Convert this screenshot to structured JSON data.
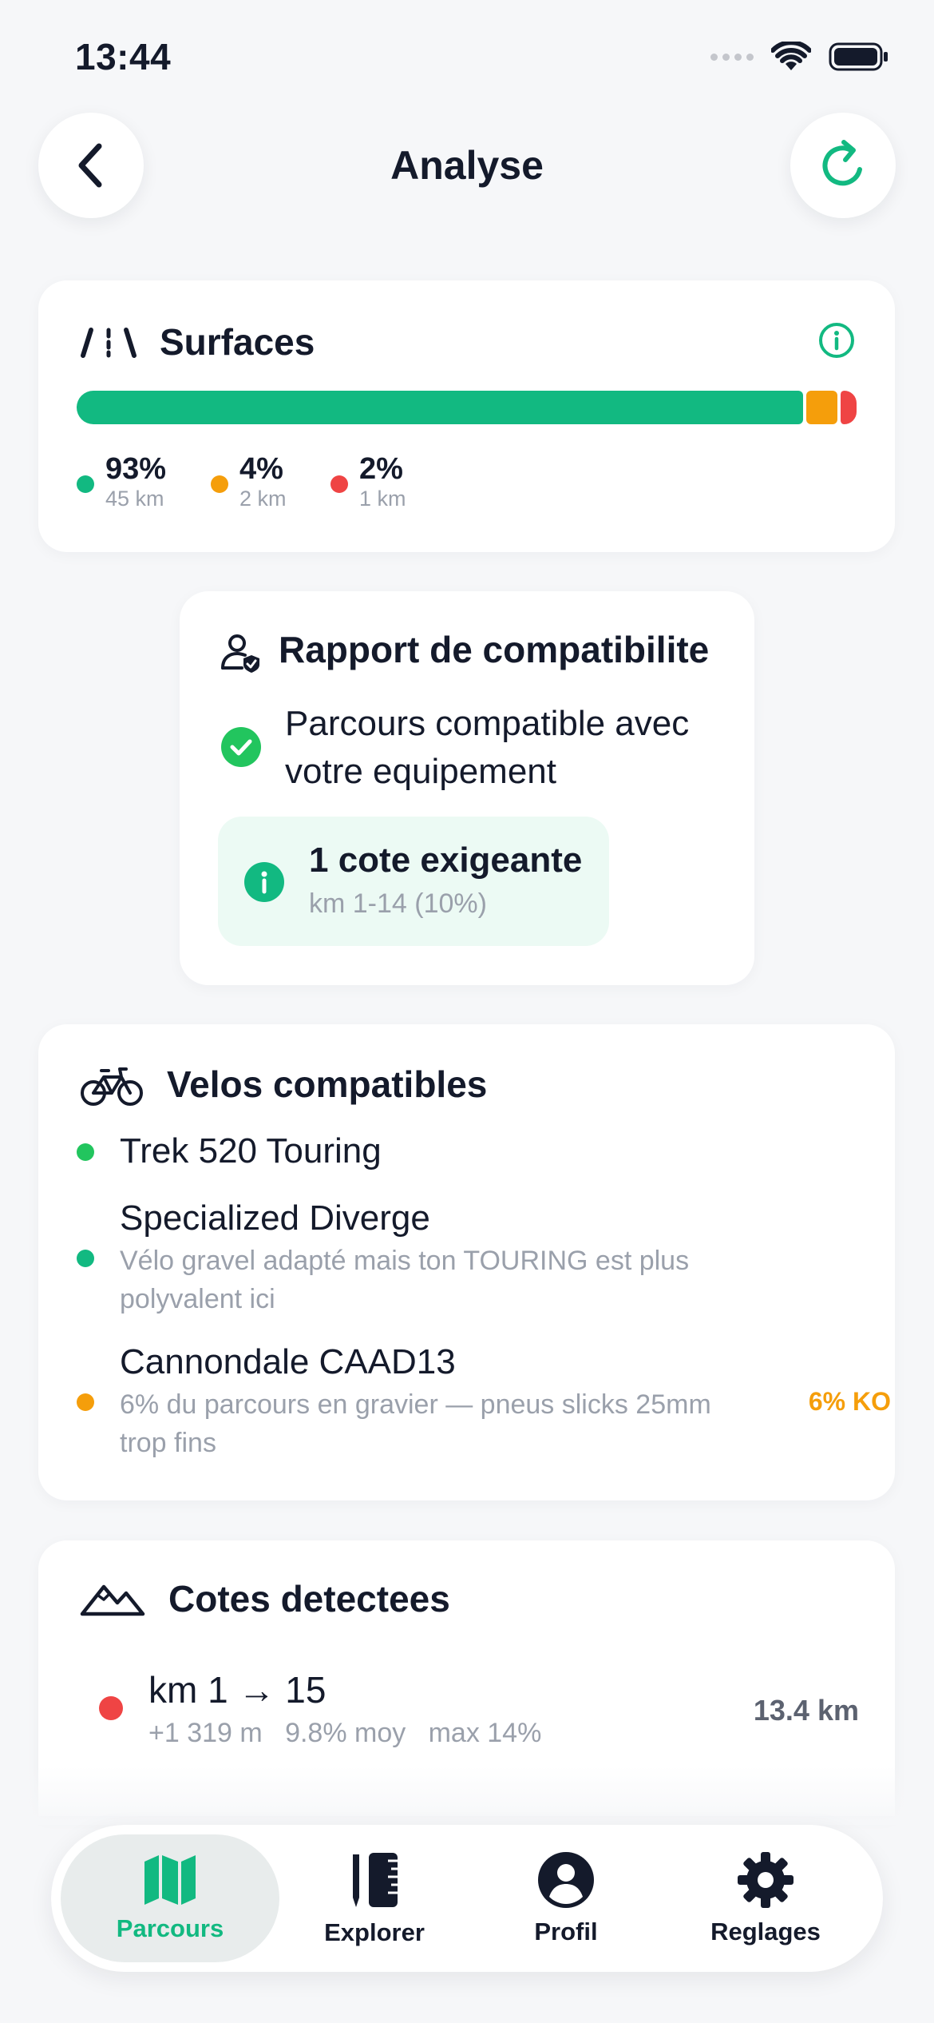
{
  "status_bar": {
    "time": "13:44"
  },
  "header": {
    "title": "Analyse",
    "back_icon": "chevron-left-icon",
    "refresh_icon": "refresh-icon"
  },
  "surfaces": {
    "title": "Surfaces",
    "segments": [
      {
        "percent": "93%",
        "km": "45 km",
        "fraction": 0.93,
        "color": "#12b981"
      },
      {
        "percent": "4%",
        "km": "2 km",
        "fraction": 0.04,
        "color": "#f59e0b"
      },
      {
        "percent": "2%",
        "km": "1 km",
        "fraction": 0.02,
        "color": "#ef4444"
      }
    ]
  },
  "compat_report": {
    "title": "Rapport de compatibilite",
    "status_line1": "Parcours compatible avec",
    "status_line2": "votre equipement",
    "callout_title": "1 cote exigeante",
    "callout_subtitle": "km 1-14 (10%)"
  },
  "bikes": {
    "title": "Velos compatibles",
    "items": [
      {
        "name": "Trek 520 Touring",
        "desc": "",
        "status_color": "#22c55e",
        "badge": ""
      },
      {
        "name": "Specialized Diverge",
        "desc": "Vélo gravel adapté mais ton TOURING est plus polyvalent ici",
        "status_color": "#12b981",
        "badge": ""
      },
      {
        "name": "Cannondale CAAD13",
        "desc": "6% du parcours en gravier — pneus slicks 25mm trop fins",
        "status_color": "#f59e0b",
        "badge": "6% KO"
      }
    ]
  },
  "climbs": {
    "title": "Cotes detectees",
    "items": [
      {
        "range": "km 1 → 15",
        "gain": "+1 319 m",
        "avg": "9.8% moy",
        "max": "max 14%",
        "distance": "13.4 km",
        "color": "#ef4444"
      }
    ]
  },
  "nav": {
    "items": [
      {
        "label": "Parcours",
        "icon": "map-icon",
        "active": true
      },
      {
        "label": "Explorer",
        "icon": "ruler-icon",
        "active": false
      },
      {
        "label": "Profil",
        "icon": "user-circle-icon",
        "active": false
      },
      {
        "label": "Reglages",
        "icon": "gear-icon",
        "active": false
      }
    ]
  },
  "colors": {
    "accent": "#12b981",
    "warning": "#f59e0b",
    "danger": "#ef4444",
    "success": "#22c55e"
  }
}
